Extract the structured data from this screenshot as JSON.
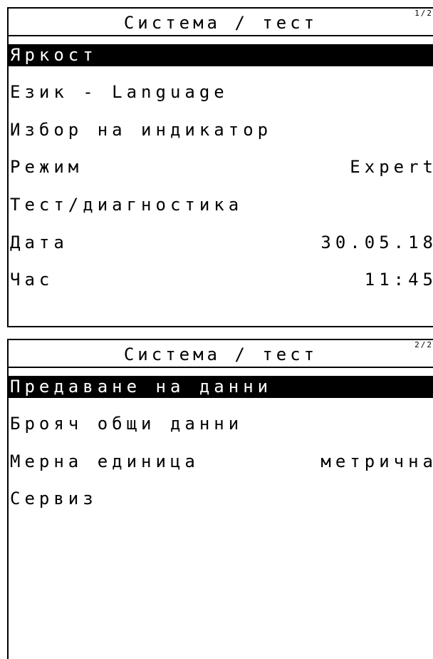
{
  "screen1": {
    "title": "Система / тест",
    "page": "1/2",
    "items": [
      {
        "label": "Яркост",
        "value": ""
      },
      {
        "label": "Език - Language",
        "value": ""
      },
      {
        "label": "Избор на индикатор",
        "value": ""
      },
      {
        "label": "Режим",
        "value": "Expert"
      },
      {
        "label": "Тест/диагностика",
        "value": ""
      },
      {
        "label": "Дата",
        "value": "30.05.18"
      },
      {
        "label": "Час",
        "value": "11:45"
      }
    ]
  },
  "screen2": {
    "title": "Система / тест",
    "page": "2/2",
    "items": [
      {
        "label": "Предаване на данни",
        "value": ""
      },
      {
        "label": "Брояч общи данни",
        "value": ""
      },
      {
        "label": "Мерна единица",
        "value": "метрична"
      },
      {
        "label": "Сервиз",
        "value": ""
      }
    ]
  },
  "colors": {
    "background": "#ffffff",
    "foreground": "#000000",
    "selection": "#000000"
  }
}
